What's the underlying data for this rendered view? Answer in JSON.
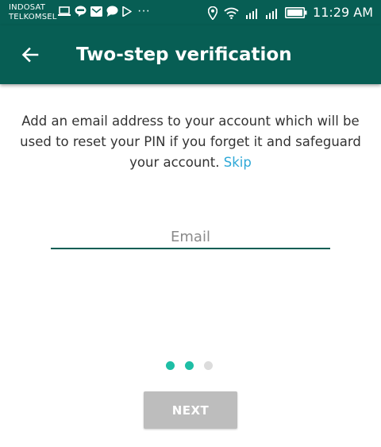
{
  "status_bar": {
    "carrier_1": "INDOSAT",
    "carrier_2": "TELKOMSEL",
    "more_notifications": "···",
    "time": "11:29 AM",
    "icons": [
      "laptop-icon",
      "line-icon",
      "mail-icon",
      "chat-icon",
      "play-store-icon",
      "location-icon",
      "wifi-icon",
      "signal-icon",
      "signal-icon",
      "battery-icon"
    ]
  },
  "app_bar": {
    "title": "Two-step verification",
    "back_icon": "arrow-back-icon",
    "color": "#075e54"
  },
  "content": {
    "description": "Add an email address to your account which will be used to reset your PIN if you forget it and safeguard your account.",
    "skip_label": "Skip",
    "email_placeholder": "Email",
    "email_value": ""
  },
  "pager": {
    "total": 3,
    "active": [
      true,
      true,
      false
    ],
    "active_color": "#1ebea5",
    "inactive_color": "#dcdcdc"
  },
  "next_button": {
    "label": "NEXT",
    "enabled": false
  },
  "colors": {
    "primary": "#075e54",
    "accent": "#2ea8d7",
    "button_disabled": "#bdbdbd"
  }
}
